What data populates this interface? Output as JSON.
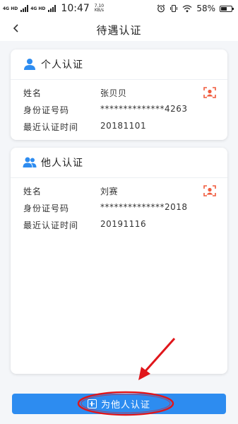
{
  "status_bar": {
    "signal_1": "4G HD",
    "signal_2": "4G HD",
    "time": "10:47",
    "net_speed_value": "7.10",
    "net_speed_unit": "KB/s",
    "battery_percent": "58%",
    "battery_level": 0.58,
    "icons": [
      "alarm-icon",
      "vibrate-icon",
      "wifi-icon",
      "battery-icon"
    ]
  },
  "navbar": {
    "back_icon": "chevron-left-icon",
    "title": "待遇认证"
  },
  "cards": [
    {
      "icon": "person-icon",
      "title": "个人认证",
      "rows": [
        {
          "label": "姓名",
          "value": "张贝贝"
        },
        {
          "label": "身份证号码",
          "value": "**************4263"
        },
        {
          "label": "最近认证时间",
          "value": "20181101"
        }
      ]
    },
    {
      "icon": "people-icon",
      "title": "他人认证",
      "rows": [
        {
          "label": "姓名",
          "value": "刘赛"
        },
        {
          "label": "身份证号码",
          "value": "**************2018"
        },
        {
          "label": "最近认证时间",
          "value": "20191116"
        }
      ]
    }
  ],
  "bottom_button": {
    "icon": "plus-box-icon",
    "label": "为他人认证"
  },
  "colors": {
    "primary": "#2d8cf0",
    "face_icon": "#f05a3c",
    "annotation": "#e0161b",
    "background": "#f4f6f9"
  }
}
